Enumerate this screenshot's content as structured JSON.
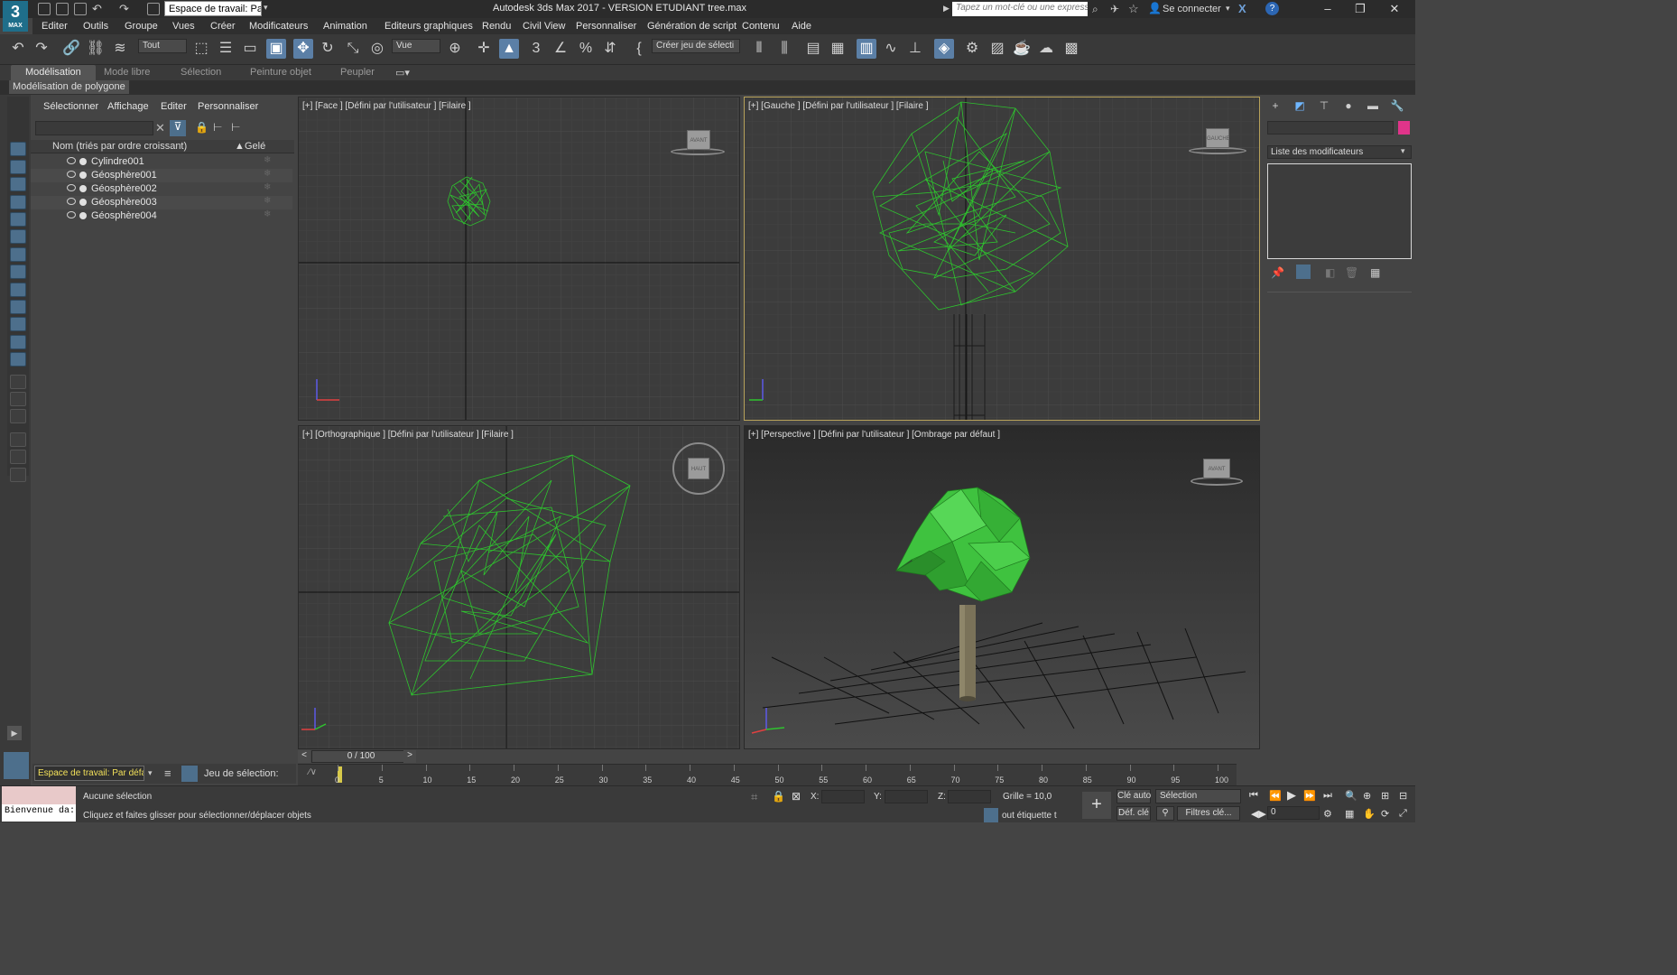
{
  "app": {
    "logo_text": "3",
    "logo_sub": "MAX",
    "title": "Autodesk 3ds Max 2017  - VERSION ETUDIANT    tree.max",
    "workspace_dropdown": "Espace de travail: Par",
    "search_placeholder": "Tapez un mot-clé ou une expression",
    "sign_in": "Se connecter"
  },
  "menu": [
    "Editer",
    "Outils",
    "Groupe",
    "Vues",
    "Créer",
    "Modificateurs",
    "Animation",
    "Editeurs graphiques",
    "Rendu",
    "Civil View",
    "Personnaliser",
    "Génération de script",
    "Contenu",
    "Aide"
  ],
  "toolbar": {
    "filter_value": "Tout",
    "ref_coord_value": "Vue",
    "selection_set_value": "Créer jeu de sélecti"
  },
  "ribbon": {
    "tabs": [
      "Modélisation",
      "Mode libre",
      "Sélection",
      "Peinture objet",
      "Peupler"
    ],
    "active_subtag": "Modélisation de polygone"
  },
  "scene_explorer": {
    "menu": [
      "Sélectionner",
      "Affichage",
      "Editer",
      "Personnaliser"
    ],
    "col_name": "Nom (triés par ordre croissant)",
    "col_sort_arrow": "▲",
    "col_frozen": "Gelé",
    "objects": [
      "Cylindre001",
      "Géosphère001",
      "Géosphère002",
      "Géosphère003",
      "Géosphère004"
    ]
  },
  "viewports": {
    "top_left": {
      "label": "[+] [Face ] [Défini par l'utilisateur ] [Filaire ]",
      "cube": "AVANT"
    },
    "top_right": {
      "label": "[+] [Gauche ] [Défini par l'utilisateur ] [Filaire ]",
      "cube": "GAUCHE"
    },
    "bottom_left": {
      "label": "[+] [Orthographique ] [Défini par l'utilisateur ] [Filaire ]",
      "cube": "HAUT"
    },
    "bottom_right": {
      "label": "[+] [Perspective ] [Défini par l'utilisateur ] [Ombrage par défaut ]",
      "cube": "AVANT"
    }
  },
  "command_panel": {
    "modifier_list": "Liste des modificateurs",
    "accent_color": "#e0348a"
  },
  "timeline": {
    "slider": "0 / 100",
    "prev": "<",
    "next": ">",
    "ticks": [
      "0",
      "5",
      "10",
      "15",
      "20",
      "25",
      "30",
      "35",
      "40",
      "45",
      "50",
      "55",
      "60",
      "65",
      "70",
      "75",
      "80",
      "85",
      "90",
      "95",
      "100"
    ]
  },
  "workspace_bar": {
    "workspace": "Espace de travail: Par défau",
    "selection_set_label": "Jeu de sélection:"
  },
  "status": {
    "welcome": "Bienvenue da:",
    "selection": "Aucune sélection",
    "hint": "Cliquez et faites glisser pour sélectionner/déplacer objets",
    "x_label": "X:",
    "y_label": "Y:",
    "z_label": "Z:",
    "grid": "Grille = 10,0",
    "auto_key": "Clé auto",
    "set_key": "Déf. clé",
    "selection_dd": "Sélection",
    "key_filters": "Filtres clé...",
    "add_tag": "out étiquette t",
    "frame": "0"
  }
}
